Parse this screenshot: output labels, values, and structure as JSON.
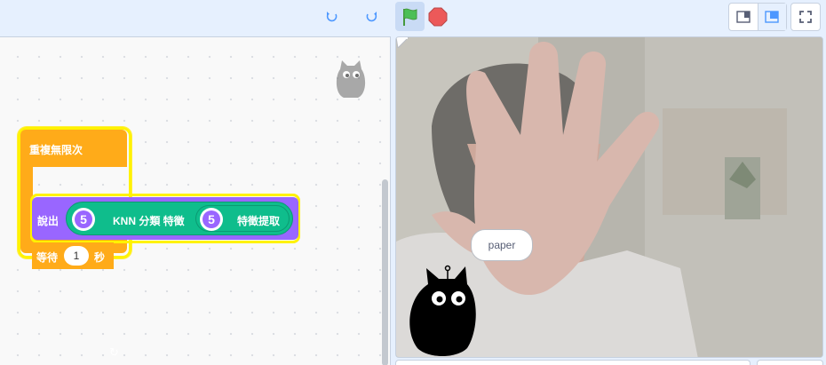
{
  "toolbar": {
    "undo_icon": "undo-icon",
    "redo_icon": "redo-icon",
    "green_flag_icon": "green-flag-icon",
    "stop_icon": "stop-icon",
    "small_stage_icon": "small-stage-icon",
    "large_stage_icon": "large-stage-icon",
    "fullscreen_icon": "fullscreen-icon",
    "accent_color": "#4c97ff",
    "flag_color": "#4cbf56",
    "stop_color": "#ec5959"
  },
  "script": {
    "forever_label": "重複無限次",
    "say_label": "說出",
    "knn_label": "KNN 分類 特徵",
    "knn_k": "5",
    "feature_label": "特徵提取",
    "feature_k": "5",
    "wait_label": "等待",
    "wait_value": "1",
    "wait_unit": "秒",
    "control_color": "#ffab19",
    "looks_color": "#9966ff",
    "extension_color": "#0fbd8c"
  },
  "stage": {
    "speech_bubble": "paper"
  }
}
